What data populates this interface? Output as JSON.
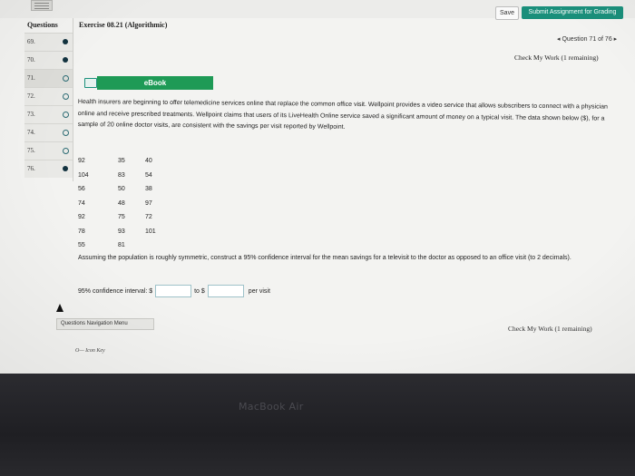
{
  "header": {
    "save_label": "Save",
    "submit_label": "Submit Assignment for Grading"
  },
  "sidebar": {
    "title": "Questions",
    "items": [
      {
        "num": "69.",
        "status": "answered"
      },
      {
        "num": "70.",
        "status": "answered"
      },
      {
        "num": "71.",
        "status": "unanswered"
      },
      {
        "num": "72.",
        "status": "unanswered"
      },
      {
        "num": "73.",
        "status": "unanswered"
      },
      {
        "num": "74.",
        "status": "unanswered"
      },
      {
        "num": "75.",
        "status": "unanswered"
      },
      {
        "num": "76.",
        "status": "answered"
      }
    ]
  },
  "main": {
    "exercise_title": "Exercise 08.21 (Algorithmic)",
    "question_position": "◂ Question 71 of 76 ▸",
    "check_work_top": "Check My Work (1 remaining)",
    "ebook_label": "eBook",
    "prompt": "Health insurers are beginning to offer telemedicine services online that replace the common office visit. Wellpoint provides a video service that allows subscribers to connect with a physician online and receive prescribed treatments. Wellpoint claims that users of its LiveHealth Online service saved a significant amount of money on a typical visit. The data shown below ($), for a sample of 20 online doctor visits, are consistent with the savings per visit reported by Wellpoint.",
    "data_rows": [
      [
        "92",
        "35",
        "40"
      ],
      [
        "104",
        "83",
        "54"
      ],
      [
        "56",
        "50",
        "38"
      ],
      [
        "74",
        "48",
        "97"
      ],
      [
        "92",
        "75",
        "72"
      ],
      [
        "78",
        "93",
        "101"
      ],
      [
        "55",
        "81",
        ""
      ]
    ],
    "follow_up": "Assuming the population is roughly symmetric, construct a 95% confidence interval for the mean savings for a televisit to the doctor as opposed to an office visit (to 2 decimals).",
    "ci_label": "95% confidence interval: $",
    "ci_to": "to $",
    "ci_unit": "per visit",
    "ci_lower_value": "",
    "ci_upper_value": "",
    "nav_menu_label": "Questions Navigation Menu",
    "check_work_bottom": "Check My Work (1 remaining)",
    "icon_key": "O— Icon Key"
  },
  "bezel": {
    "brand": "MacBook Air"
  },
  "colors": {
    "submit": "#1a8f7b",
    "ebook": "#1e9a56",
    "dot": "#12323f"
  }
}
